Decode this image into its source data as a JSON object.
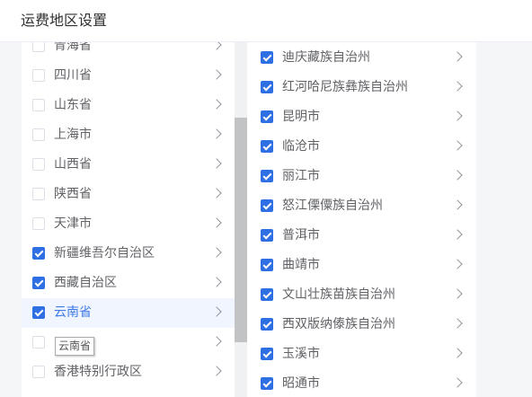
{
  "page": {
    "title": "运费地区设置"
  },
  "provinces": [
    {
      "label": "青海省",
      "checked": false,
      "active": false
    },
    {
      "label": "四川省",
      "checked": false,
      "active": false
    },
    {
      "label": "山东省",
      "checked": false,
      "active": false
    },
    {
      "label": "上海市",
      "checked": false,
      "active": false
    },
    {
      "label": "山西省",
      "checked": false,
      "active": false
    },
    {
      "label": "陕西省",
      "checked": false,
      "active": false
    },
    {
      "label": "天津市",
      "checked": false,
      "active": false
    },
    {
      "label": "新疆维吾尔自治区",
      "checked": true,
      "active": false
    },
    {
      "label": "西藏自治区",
      "checked": true,
      "active": false
    },
    {
      "label": "云南省",
      "checked": true,
      "active": true
    },
    {
      "label": "",
      "checked": false,
      "active": false
    },
    {
      "label": "香港特别行政区",
      "checked": false,
      "active": false
    }
  ],
  "cities": [
    {
      "label": "迪庆藏族自治州",
      "checked": true
    },
    {
      "label": "红河哈尼族彝族自治州",
      "checked": true
    },
    {
      "label": "昆明市",
      "checked": true
    },
    {
      "label": "临沧市",
      "checked": true
    },
    {
      "label": "丽江市",
      "checked": true
    },
    {
      "label": "怒江傈僳族自治州",
      "checked": true
    },
    {
      "label": "普洱市",
      "checked": true
    },
    {
      "label": "曲靖市",
      "checked": true
    },
    {
      "label": "文山壮族苗族自治州",
      "checked": true
    },
    {
      "label": "西双版纳傣族自治州",
      "checked": true
    },
    {
      "label": "玉溪市",
      "checked": true
    },
    {
      "label": "昭通市",
      "checked": true
    }
  ],
  "tooltip": {
    "text": "云南省"
  },
  "scrollbar": {
    "position": 0.58
  },
  "colors": {
    "accent": "#2f6fe4",
    "active_bg": "#f0f5ff",
    "active_text": "#3f7be8"
  }
}
